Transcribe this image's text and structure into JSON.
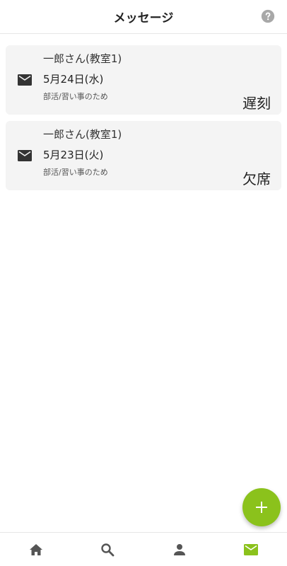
{
  "header": {
    "title": "メッセージ",
    "help_icon": "help-circle-icon"
  },
  "messages": [
    {
      "icon": "mail-icon",
      "name": "一郎さん(教室1)",
      "date": "5月24日(水)",
      "reason": "部活/習い事のため",
      "status": "遅刻"
    },
    {
      "icon": "mail-icon",
      "name": "一郎さん(教室1)",
      "date": "5月23日(火)",
      "reason": "部活/習い事のため",
      "status": "欠席"
    }
  ],
  "fab": {
    "icon": "plus-icon"
  },
  "bottom_nav": {
    "items": [
      {
        "icon": "home-icon",
        "active": false
      },
      {
        "icon": "search-icon",
        "active": false
      },
      {
        "icon": "person-icon",
        "active": false
      },
      {
        "icon": "mail-icon",
        "active": true
      }
    ]
  },
  "colors": {
    "accent": "#8bc21c",
    "card_bg": "#f4f4f4",
    "nav_icon": "#555555",
    "help_icon": "#a8a8a8"
  }
}
